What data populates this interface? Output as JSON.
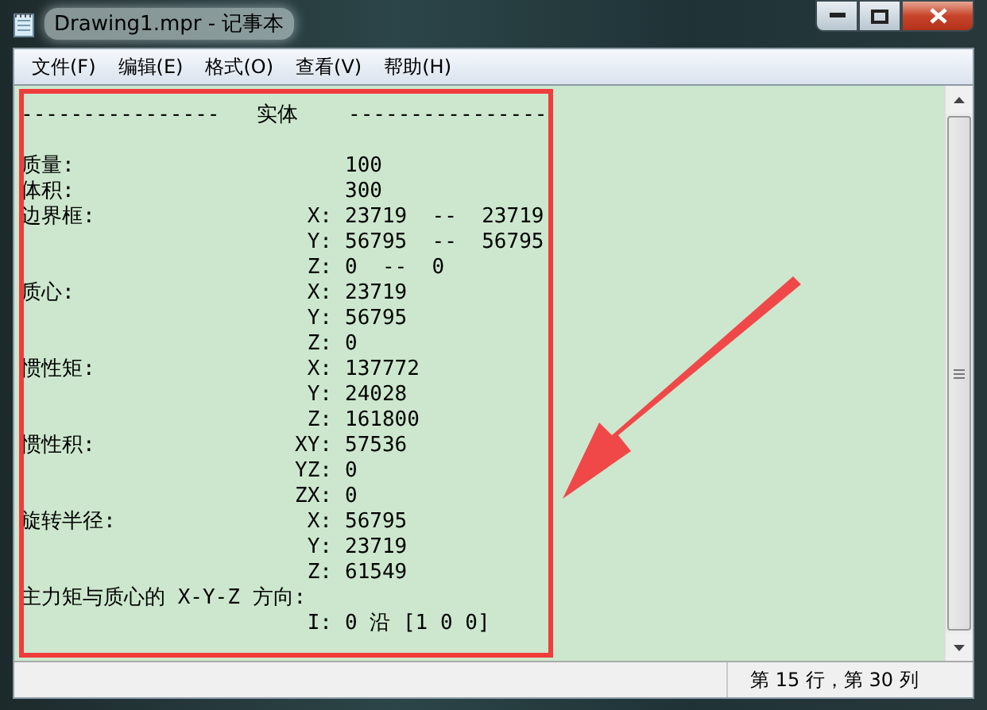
{
  "window": {
    "title": "Drawing1.mpr - 记事本"
  },
  "menu": [
    {
      "label": "文件(F)"
    },
    {
      "label": "编辑(E)"
    },
    {
      "label": "格式(O)"
    },
    {
      "label": "查看(V)"
    },
    {
      "label": "帮助(H)"
    }
  ],
  "editor": {
    "lines": [
      {
        "kind": "heading",
        "text": "----------------   实体    ----------------"
      },
      {
        "kind": "blank"
      },
      {
        "kind": "field",
        "label": "质量:",
        "value": "100"
      },
      {
        "kind": "field",
        "label": "体积:",
        "value": "300"
      },
      {
        "kind": "field",
        "label": "边界框:",
        "axis": "X:",
        "value": "23719  --  23719"
      },
      {
        "kind": "field",
        "axis": "Y:",
        "value": "56795  --  56795"
      },
      {
        "kind": "field",
        "axis": "Z:",
        "value": "0  --  0"
      },
      {
        "kind": "field",
        "label": "质心:",
        "axis": "X:",
        "value": "23719"
      },
      {
        "kind": "field",
        "axis": "Y:",
        "value": "56795"
      },
      {
        "kind": "field",
        "axis": "Z:",
        "value": "0"
      },
      {
        "kind": "field",
        "label": "惯性矩:",
        "axis": "X:",
        "value": "137772"
      },
      {
        "kind": "field",
        "axis": "Y:",
        "value": "24028"
      },
      {
        "kind": "field",
        "axis": "Z:",
        "value": "161800"
      },
      {
        "kind": "field",
        "label": "惯性积:",
        "axis": "XY:",
        "value": "57536"
      },
      {
        "kind": "field",
        "axis": "YZ:",
        "value": "0"
      },
      {
        "kind": "field",
        "axis": "ZX:",
        "value": "0"
      },
      {
        "kind": "field",
        "label": "旋转半径:",
        "axis": "X:",
        "value": "56795"
      },
      {
        "kind": "field",
        "axis": "Y:",
        "value": "23719"
      },
      {
        "kind": "field",
        "axis": "Z:",
        "value": "61549"
      },
      {
        "kind": "heading",
        "text": "主力矩与质心的 X-Y-Z 方向:"
      },
      {
        "kind": "field",
        "axis": "I:",
        "value": "0 沿 [1 0 0]"
      }
    ]
  },
  "status_bar": {
    "position": "第 15 行，第 30 列"
  }
}
